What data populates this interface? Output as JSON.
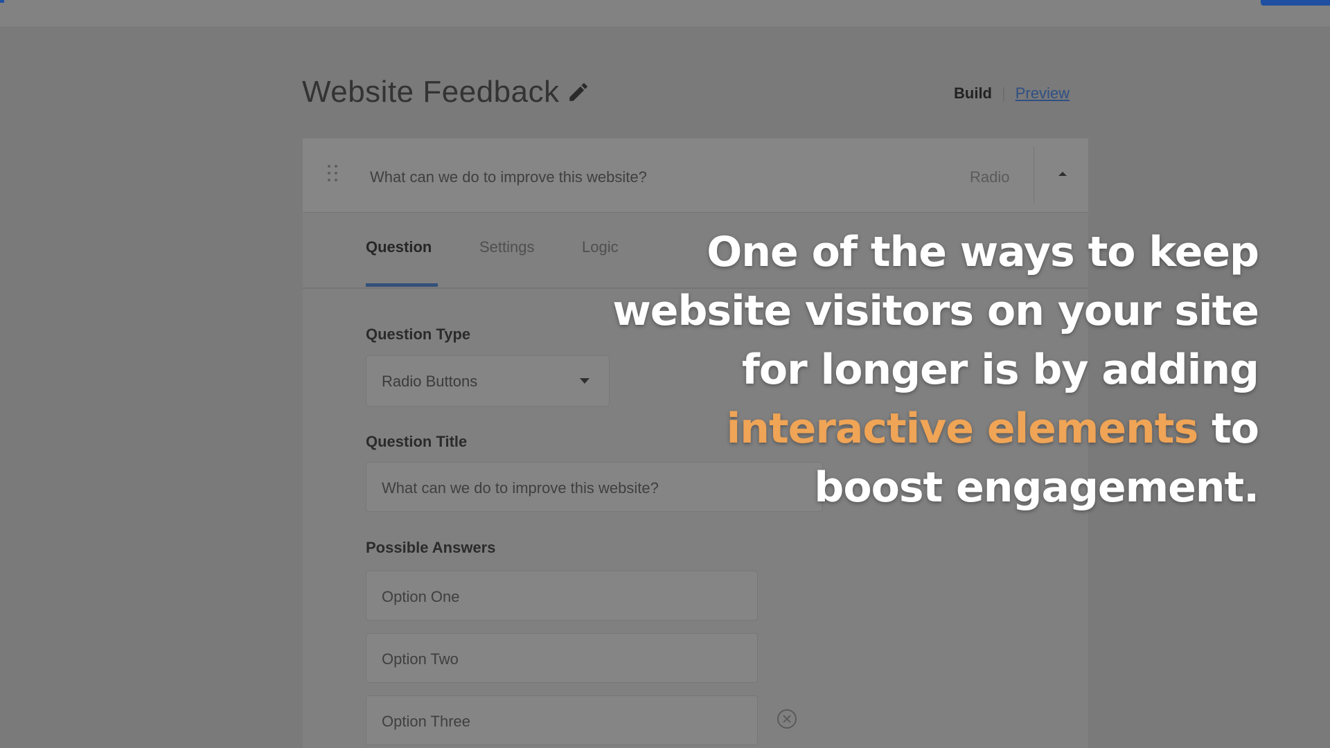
{
  "colors": {
    "accent": "#34507a",
    "highlight": "#efa456",
    "overlay_text": "#ffffff",
    "link": "#2f4f83"
  },
  "header": {
    "title": "Website Feedback",
    "edit_icon": "pencil-icon",
    "build_label": "Build",
    "separator": "|",
    "preview_label": "Preview"
  },
  "question_card": {
    "summary": "What can we do to improve this website?",
    "type_label": "Radio",
    "collapse_icon": "chevron-up-icon",
    "drag_icon": "drag-handle-icon",
    "tabs": [
      {
        "label": "Question",
        "active": true
      },
      {
        "label": "Settings",
        "active": false
      },
      {
        "label": "Logic",
        "active": false
      }
    ],
    "question_type": {
      "label": "Question Type",
      "value": "Radio Buttons"
    },
    "question_title": {
      "label": "Question Title",
      "value": "What can we do to improve this website?"
    },
    "possible_answers": {
      "label": "Possible Answers",
      "options": [
        "Option One",
        "Option Two",
        "Option Three"
      ],
      "remove_icon": "remove-circle-icon"
    }
  },
  "overlay": {
    "line1": "One of the ways to keep",
    "line2": "website visitors on your site",
    "line3": "for longer is by adding",
    "highlight": "interactive elements",
    "line4_rest": "to",
    "line5": "boost engagement."
  }
}
